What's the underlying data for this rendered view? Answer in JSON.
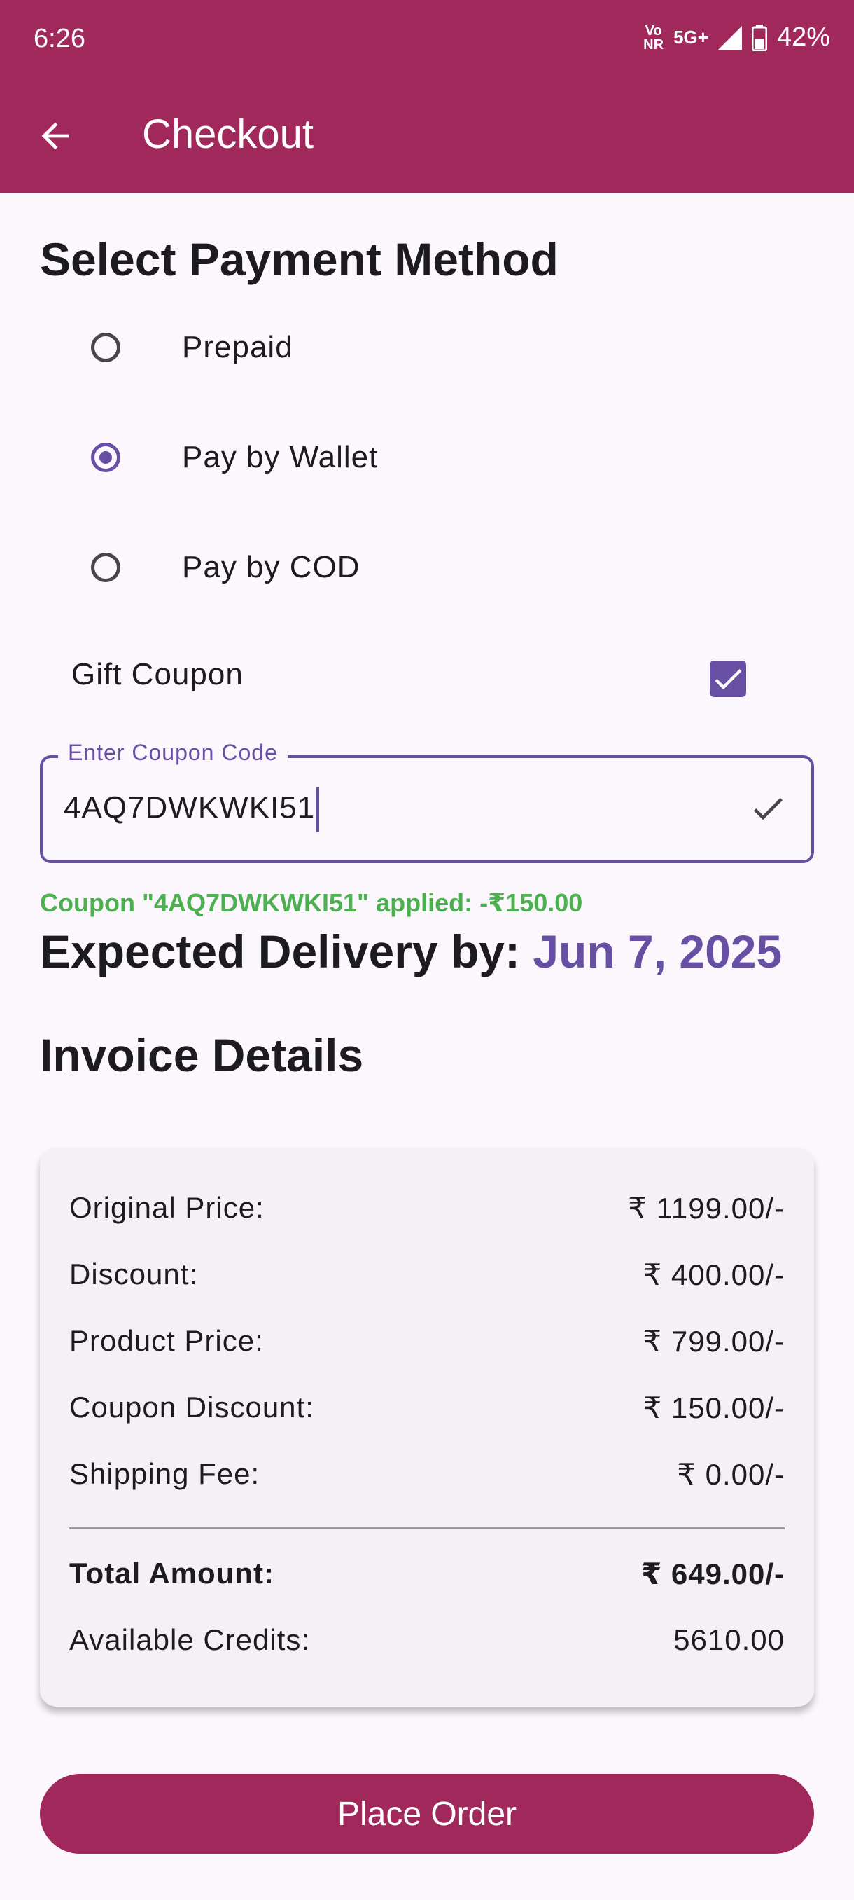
{
  "status_bar": {
    "time": "6:26",
    "network_top": "Vo",
    "network_bottom": "NR",
    "network_5g": "5G+",
    "battery": "42%"
  },
  "app_bar": {
    "title": "Checkout",
    "back_icon": "arrow-back-icon"
  },
  "payment": {
    "heading": "Select Payment Method",
    "options": [
      {
        "label": "Prepaid",
        "selected": false
      },
      {
        "label": "Pay by Wallet",
        "selected": true
      },
      {
        "label": "Pay by COD",
        "selected": false
      }
    ]
  },
  "gift_coupon": {
    "label": "Gift Coupon",
    "checked": true
  },
  "coupon_field": {
    "label": "Enter Coupon Code",
    "value": "4AQ7DWKWKI51"
  },
  "coupon_status": "Coupon \"4AQ7DWKWKI51\" applied: -₹150.00",
  "delivery": {
    "label": "Expected Delivery by:",
    "date": "Jun 7, 2025"
  },
  "invoice": {
    "heading": "Invoice Details",
    "rows": [
      {
        "label": "Original Price:",
        "value": "₹ 1199.00/-"
      },
      {
        "label": "Discount:",
        "value": "₹ 400.00/-"
      },
      {
        "label": "Product Price:",
        "value": "₹ 799.00/-"
      },
      {
        "label": "Coupon Discount:",
        "value": "₹ 150.00/-"
      },
      {
        "label": "Shipping Fee:",
        "value": "₹ 0.00/-"
      }
    ],
    "total_label": "Total Amount:",
    "total_value": "₹ 649.00/-",
    "credits_label": "Available Credits:",
    "credits_value": "5610.00"
  },
  "place_order_label": "Place Order",
  "colors": {
    "brand": "#a0285a",
    "accent": "#6750a4",
    "success": "#4caf50"
  }
}
